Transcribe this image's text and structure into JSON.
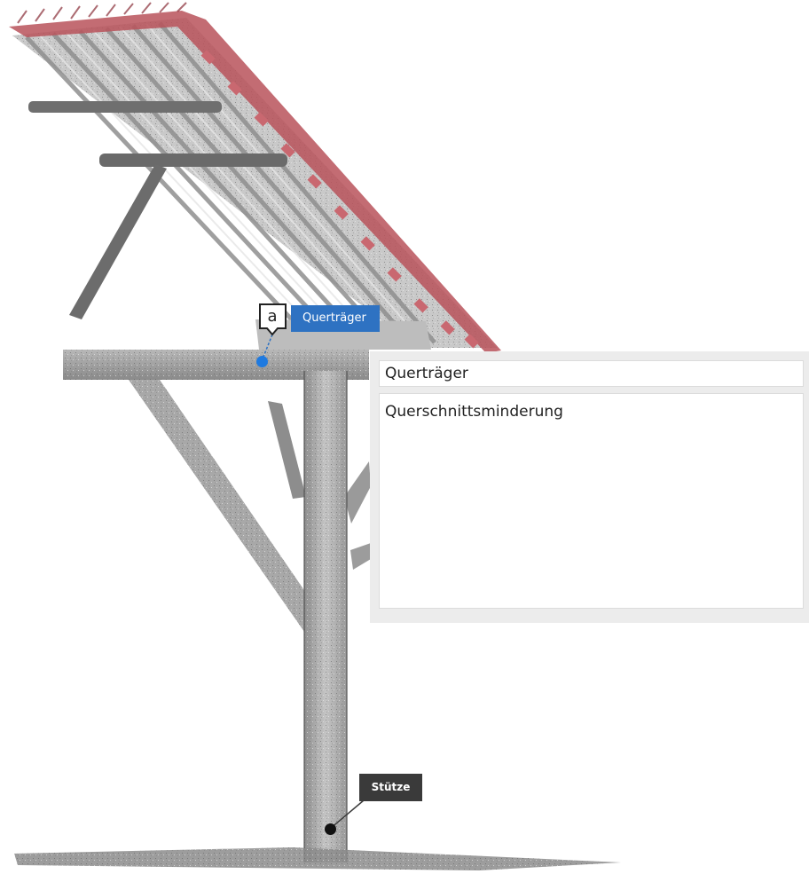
{
  "annotations": [
    {
      "marker_letter": "a",
      "label": "Querträger",
      "label_color": "#2e72c2",
      "point_color": "#1f7ae0"
    },
    {
      "label": "Stütze",
      "label_color": "#3a3a3a",
      "point_color": "#111111"
    }
  ],
  "info_panel": {
    "title": "Querträger",
    "description": "Querschnittsminderung"
  },
  "scene": {
    "roof_tile_color": "#b9525a",
    "wood_color": "#a9a9a9"
  }
}
